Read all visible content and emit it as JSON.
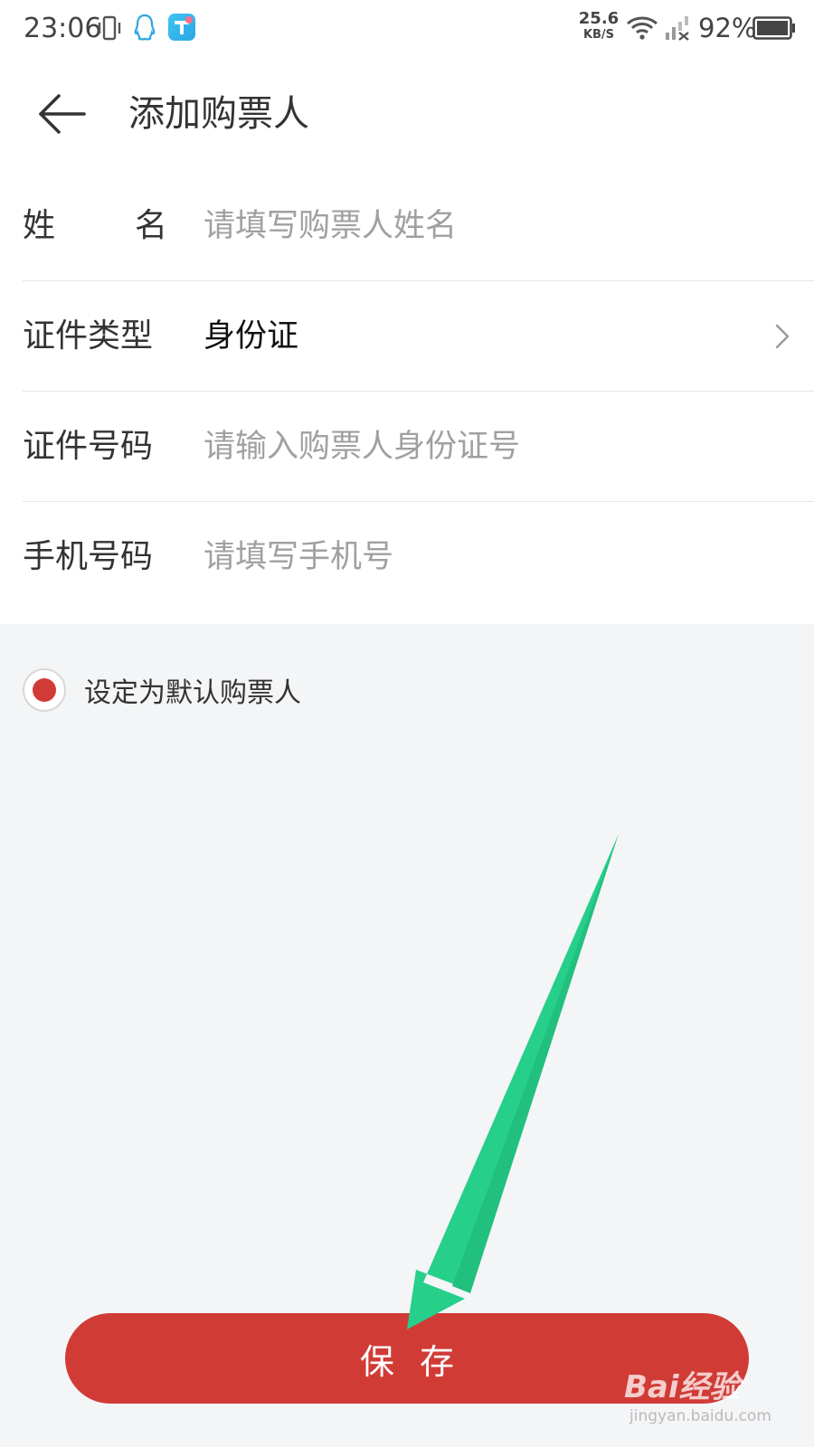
{
  "status_bar": {
    "time": "23:06",
    "net_speed_value": "25.6",
    "net_speed_unit": "KB/S",
    "battery": "92%"
  },
  "header": {
    "title": "添加购票人"
  },
  "form": {
    "name": {
      "label_a": "姓",
      "label_b": "名",
      "placeholder": "请填写购票人姓名"
    },
    "id_type": {
      "label": "证件类型",
      "value": "身份证"
    },
    "id_number": {
      "label": "证件号码",
      "placeholder": "请输入购票人身份证号"
    },
    "phone": {
      "label": "手机号码",
      "placeholder": "请填写手机号"
    }
  },
  "default_option": {
    "label": "设定为默认购票人",
    "checked": true
  },
  "save_label": "保存",
  "watermark": {
    "brand": "Bai经验",
    "sub": "jingyan.baidu.com"
  },
  "colors": {
    "accent": "#d13b36",
    "arrow": "#26cf8a",
    "background": "#f4f5f7"
  }
}
